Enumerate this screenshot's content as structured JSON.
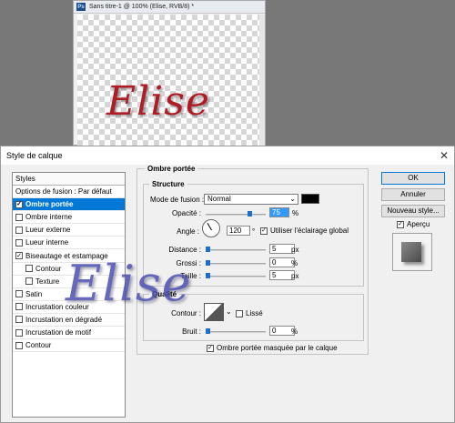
{
  "document": {
    "icon_label": "Ps",
    "title": "Sans titre-1 @ 100% (Elise, RVB/8) *",
    "canvas_text": "Elise"
  },
  "dialog": {
    "title": "Style de calque",
    "close_glyph": "✕",
    "styles_header": "Styles",
    "styles": [
      {
        "label": "Options de fusion : Par défaut",
        "checkbox": false,
        "checked": false,
        "selected": false
      },
      {
        "label": "Ombre portée",
        "checkbox": true,
        "checked": true,
        "selected": true
      },
      {
        "label": "Ombre interne",
        "checkbox": true,
        "checked": false,
        "selected": false
      },
      {
        "label": "Lueur externe",
        "checkbox": true,
        "checked": false,
        "selected": false
      },
      {
        "label": "Lueur interne",
        "checkbox": true,
        "checked": false,
        "selected": false
      },
      {
        "label": "Biseautage et estampage",
        "checkbox": true,
        "checked": true,
        "selected": false
      },
      {
        "label": "Contour",
        "checkbox": true,
        "checked": false,
        "selected": false,
        "sub": true
      },
      {
        "label": "Texture",
        "checkbox": true,
        "checked": false,
        "selected": false,
        "sub": true
      },
      {
        "label": "Satin",
        "checkbox": true,
        "checked": false,
        "selected": false
      },
      {
        "label": "Incrustation couleur",
        "checkbox": true,
        "checked": false,
        "selected": false
      },
      {
        "label": "Incrustation en dégradé",
        "checkbox": true,
        "checked": false,
        "selected": false
      },
      {
        "label": "Incrustation de motif",
        "checkbox": true,
        "checked": false,
        "selected": false
      },
      {
        "label": "Contour",
        "checkbox": true,
        "checked": false,
        "selected": false
      }
    ],
    "group_title": "Ombre portée",
    "structure_title": "Structure",
    "blend_mode_label": "Mode de fusion :",
    "blend_mode_value": "Normal",
    "shadow_color": "#000000",
    "opacity_label": "Opacité :",
    "opacity_value": "75",
    "angle_label": "Angle :",
    "angle_value": "120",
    "degree_symbol": "°",
    "global_light_label": "Utiliser l'éclairage global",
    "distance_label": "Distance :",
    "distance_value": "5",
    "spread_label": "Grossi :",
    "spread_value": "0",
    "size_label": "Taille :",
    "size_value": "5",
    "quality_title": "Qualité",
    "contour_label": "Contour :",
    "smooth_label": "Lissé",
    "noise_label": "Bruit :",
    "noise_value": "0",
    "knockout_label": "Ombre portée masquée par le calque",
    "units": {
      "percent": "%",
      "px": "px"
    },
    "ok_label": "OK",
    "cancel_label": "Annuler",
    "new_style_label": "Nouveau style...",
    "preview_label": "Aperçu",
    "overlay_text": "Elise",
    "accent_color": "#0078d7"
  }
}
